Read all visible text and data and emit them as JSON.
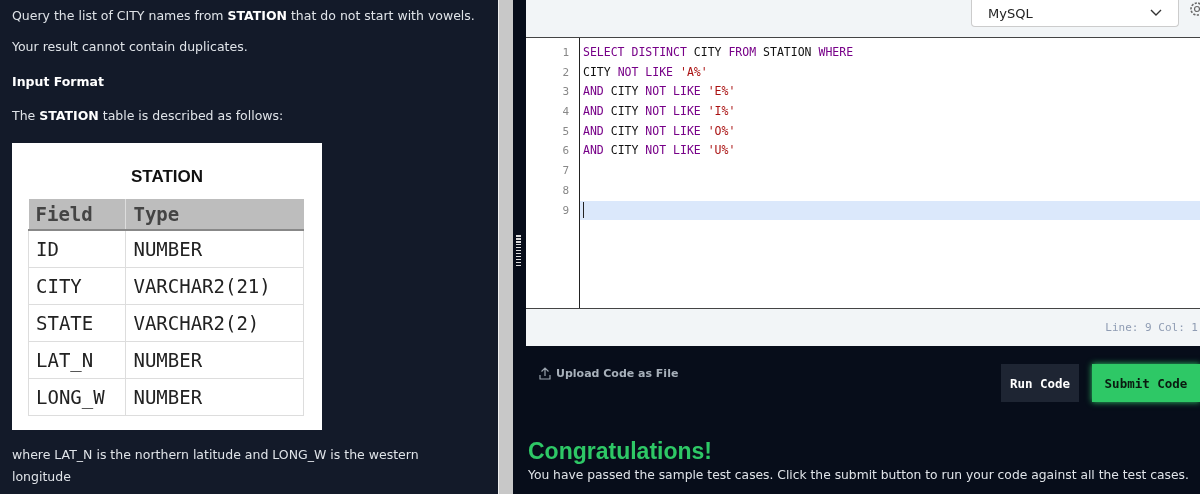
{
  "problem": {
    "paragraphs": [
      {
        "kind": "text",
        "text": "Query the list of CITY names from **STATION** that do not start with vowels."
      },
      {
        "kind": "text",
        "text": "Your result cannot contain duplicates."
      },
      {
        "kind": "heading",
        "text": "Input Format"
      },
      {
        "kind": "text",
        "text": "The **STATION** table is described as follows:"
      }
    ],
    "table": {
      "title": "STATION",
      "columns": [
        "Field",
        "Type"
      ],
      "rows": [
        [
          "ID",
          "NUMBER"
        ],
        [
          "CITY",
          "VARCHAR2(21)"
        ],
        [
          "STATE",
          "VARCHAR2(2)"
        ],
        [
          "LAT_N",
          "NUMBER"
        ],
        [
          "LONG_W",
          "NUMBER"
        ]
      ]
    },
    "footer": "where LAT_N is the northern latitude and LONG_W is the western longitude"
  },
  "editor": {
    "language": "MySQL",
    "lines": [
      {
        "number": "1",
        "current": false,
        "tokens": [
          {
            "kind": "keyword",
            "text": "SELECT DISTINCT"
          },
          {
            "kind": "name",
            "text": "CITY"
          },
          {
            "kind": "keyword",
            "text": "FROM"
          },
          {
            "kind": "name",
            "text": "STATION"
          },
          {
            "kind": "keyword",
            "text": "WHERE"
          }
        ]
      },
      {
        "number": "2",
        "current": false,
        "tokens": [
          {
            "kind": "name",
            "text": "CITY"
          },
          {
            "kind": "keyword",
            "text": "NOT LIKE"
          },
          {
            "kind": "string",
            "text": "'A%'"
          }
        ]
      },
      {
        "number": "3",
        "current": false,
        "tokens": [
          {
            "kind": "keyword",
            "text": "AND"
          },
          {
            "kind": "name",
            "text": "CITY"
          },
          {
            "kind": "keyword",
            "text": "NOT LIKE"
          },
          {
            "kind": "string",
            "text": "'E%'"
          }
        ]
      },
      {
        "number": "4",
        "current": false,
        "tokens": [
          {
            "kind": "keyword",
            "text": "AND"
          },
          {
            "kind": "name",
            "text": "CITY"
          },
          {
            "kind": "keyword",
            "text": "NOT LIKE"
          },
          {
            "kind": "string",
            "text": "'I%'"
          }
        ]
      },
      {
        "number": "5",
        "current": false,
        "tokens": [
          {
            "kind": "keyword",
            "text": "AND"
          },
          {
            "kind": "name",
            "text": "CITY"
          },
          {
            "kind": "keyword",
            "text": "NOT LIKE"
          },
          {
            "kind": "string",
            "text": "'O%'"
          }
        ]
      },
      {
        "number": "6",
        "current": false,
        "tokens": [
          {
            "kind": "keyword",
            "text": "AND"
          },
          {
            "kind": "name",
            "text": "CITY"
          },
          {
            "kind": "keyword",
            "text": "NOT LIKE"
          },
          {
            "kind": "string",
            "text": "'U%'"
          }
        ]
      },
      {
        "number": "7",
        "current": false
      },
      {
        "number": "8",
        "current": false
      },
      {
        "number": "9",
        "current": true
      }
    ],
    "status": "Line: 9 Col: 1"
  },
  "actions": {
    "upload": "Upload Code as File",
    "run": "Run Code",
    "submit": "Submit Code"
  },
  "result": {
    "title": "Congratulations!",
    "message": "You have passed the sample test cases. Click the submit button to run your code against all the test cases."
  }
}
